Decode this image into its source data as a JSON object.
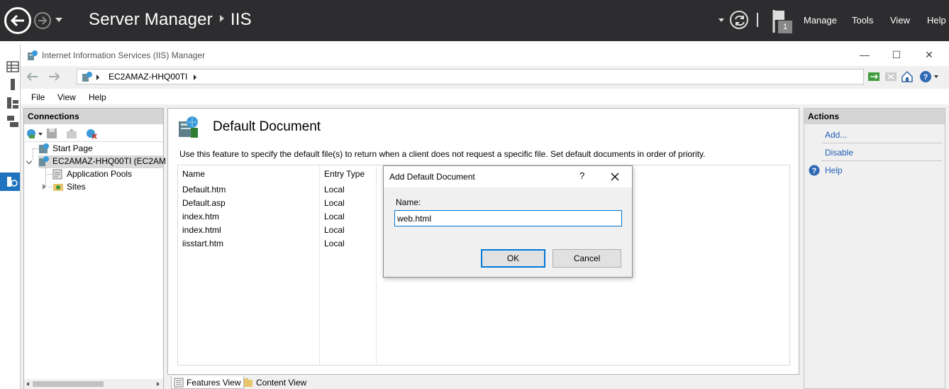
{
  "server_manager": {
    "title": "Server Manager",
    "breadcrumb": "IIS",
    "notification_count": "1",
    "menu": [
      "Manage",
      "Tools",
      "View",
      "Help"
    ]
  },
  "iis_window": {
    "title": "Internet Information Services (IIS) Manager",
    "address_path": "EC2AMAZ-HHQ00TI",
    "menu": [
      "File",
      "View",
      "Help"
    ]
  },
  "connections": {
    "header": "Connections",
    "tree": {
      "start_page": "Start Page",
      "server": "EC2AMAZ-HHQ00TI (EC2AM",
      "app_pools": "Application Pools",
      "sites": "Sites"
    }
  },
  "feature": {
    "title": "Default Document",
    "description": "Use this feature to specify the default file(s) to return when a client does not request a specific file. Set default documents in order of priority.",
    "columns": [
      "Name",
      "Entry Type"
    ],
    "rows": [
      {
        "name": "Default.htm",
        "entry_type": "Local"
      },
      {
        "name": "Default.asp",
        "entry_type": "Local"
      },
      {
        "name": "index.htm",
        "entry_type": "Local"
      },
      {
        "name": "index.html",
        "entry_type": "Local"
      },
      {
        "name": "iisstart.htm",
        "entry_type": "Local"
      }
    ]
  },
  "view_tabs": {
    "features": "Features View",
    "content": "Content View"
  },
  "actions": {
    "header": "Actions",
    "add": "Add...",
    "disable": "Disable",
    "help": "Help"
  },
  "dialog": {
    "title": "Add Default Document",
    "help_glyph": "?",
    "name_label": "Name:",
    "name_value": "web.html",
    "ok": "OK",
    "cancel": "Cancel"
  },
  "colors": {
    "sm_bar": "#2d2d30",
    "accent": "#0078d7",
    "link": "#1e5fb4"
  }
}
